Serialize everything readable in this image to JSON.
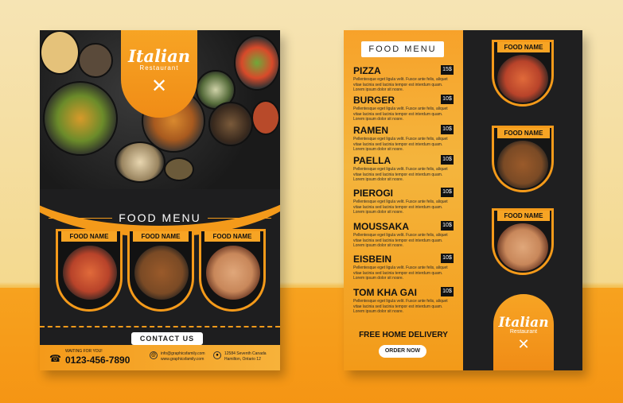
{
  "brand": {
    "name": "Italian",
    "subtitle": "Restaurant"
  },
  "flyer1": {
    "menu_title": "FOOD MENU",
    "cards": [
      {
        "label": "FOOD NAME",
        "color": "#b8432a"
      },
      {
        "label": "FOOD NAME",
        "color": "#7a4a25"
      },
      {
        "label": "FOOD NAME",
        "color": "#c8875a"
      }
    ],
    "contact_label": "CONTACT US",
    "phone_label": "WAITING FOR YOU!",
    "phone": "0123-456-7890",
    "email_lines": [
      "info@graphicsfamily.com",
      "www.graphicsfamily.com"
    ],
    "address_lines": [
      "12584 Seventh Canada",
      "Hamilton, Ontario 12"
    ]
  },
  "flyer2": {
    "menu_title": "FOOD MENU",
    "items": [
      {
        "name": "PIZZA",
        "price": "15$"
      },
      {
        "name": "BURGER",
        "price": "10$"
      },
      {
        "name": "RAMEN",
        "price": "10$"
      },
      {
        "name": "PAELLA",
        "price": "10$"
      },
      {
        "name": "PIEROGI",
        "price": "10$"
      },
      {
        "name": "MOUSSAKA",
        "price": "10$"
      },
      {
        "name": "EISBEIN",
        "price": "10$"
      },
      {
        "name": "TOM KHA GAI",
        "price": "10$"
      }
    ],
    "item_desc": "Pellentesque eget ligula velit. Fusce ante felis, aliquet vitae lacinia sed lacinia tempor est interdum quam. Lorem ipsum dolor sit nosre.",
    "delivery": "FREE HOME DELIVERY",
    "order_label": "ORDER NOW",
    "cards": [
      {
        "label": "FOOD NAME",
        "color": "#b8432a"
      },
      {
        "label": "FOOD NAME",
        "color": "#7a4a25"
      },
      {
        "label": "FOOD NAME",
        "color": "#c8875a"
      }
    ]
  },
  "colors": {
    "accent": "#f49a1a",
    "dark": "#1e1e1f"
  }
}
